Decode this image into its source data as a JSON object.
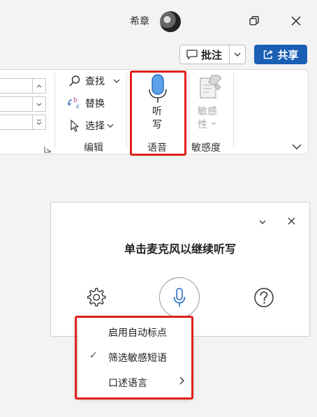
{
  "titlebar": {
    "user_name": "希章",
    "avatar_icon": "user-avatar",
    "restore_icon": "restore-window-icon",
    "close_icon": "close-window-icon"
  },
  "top_buttons": {
    "comment_label": "批注",
    "share_label": "共享",
    "share_color": "#1a5fb4"
  },
  "ribbon": {
    "editing": {
      "find_label": "查找",
      "replace_label": "替换",
      "select_label": "选择",
      "group_label": "编辑"
    },
    "voice": {
      "dictate_line1": "听",
      "dictate_line2": "写",
      "group_label": "语音"
    },
    "sensitivity": {
      "label_line1": "敏感",
      "label_line2": "性",
      "group_label": "敏感度"
    }
  },
  "dictation_panel": {
    "title": "单击麦克风以继续听写",
    "settings_icon": "gear-icon",
    "mic_icon": "microphone-icon",
    "help_icon": "help-icon"
  },
  "context_menu": {
    "items": [
      {
        "label": "启用自动标点",
        "checked": false,
        "submenu": false
      },
      {
        "label": "筛选敏感短语",
        "checked": true,
        "submenu": false
      },
      {
        "label": "口述语言",
        "checked": false,
        "submenu": true
      }
    ]
  },
  "colors": {
    "highlight": "#e0201b",
    "mic_blue": "#2b6cc4"
  }
}
